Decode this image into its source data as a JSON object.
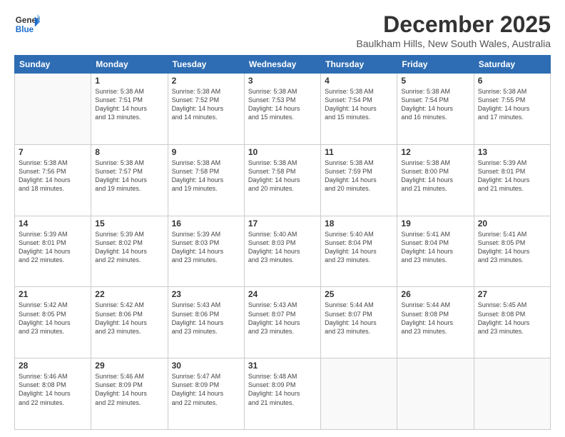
{
  "logo": {
    "line1": "General",
    "line2": "Blue"
  },
  "title": "December 2025",
  "location": "Baulkham Hills, New South Wales, Australia",
  "days_header": [
    "Sunday",
    "Monday",
    "Tuesday",
    "Wednesday",
    "Thursday",
    "Friday",
    "Saturday"
  ],
  "weeks": [
    [
      {
        "day": "",
        "lines": []
      },
      {
        "day": "1",
        "lines": [
          "Sunrise: 5:38 AM",
          "Sunset: 7:51 PM",
          "Daylight: 14 hours",
          "and 13 minutes."
        ]
      },
      {
        "day": "2",
        "lines": [
          "Sunrise: 5:38 AM",
          "Sunset: 7:52 PM",
          "Daylight: 14 hours",
          "and 14 minutes."
        ]
      },
      {
        "day": "3",
        "lines": [
          "Sunrise: 5:38 AM",
          "Sunset: 7:53 PM",
          "Daylight: 14 hours",
          "and 15 minutes."
        ]
      },
      {
        "day": "4",
        "lines": [
          "Sunrise: 5:38 AM",
          "Sunset: 7:54 PM",
          "Daylight: 14 hours",
          "and 15 minutes."
        ]
      },
      {
        "day": "5",
        "lines": [
          "Sunrise: 5:38 AM",
          "Sunset: 7:54 PM",
          "Daylight: 14 hours",
          "and 16 minutes."
        ]
      },
      {
        "day": "6",
        "lines": [
          "Sunrise: 5:38 AM",
          "Sunset: 7:55 PM",
          "Daylight: 14 hours",
          "and 17 minutes."
        ]
      }
    ],
    [
      {
        "day": "7",
        "lines": [
          "Sunrise: 5:38 AM",
          "Sunset: 7:56 PM",
          "Daylight: 14 hours",
          "and 18 minutes."
        ]
      },
      {
        "day": "8",
        "lines": [
          "Sunrise: 5:38 AM",
          "Sunset: 7:57 PM",
          "Daylight: 14 hours",
          "and 19 minutes."
        ]
      },
      {
        "day": "9",
        "lines": [
          "Sunrise: 5:38 AM",
          "Sunset: 7:58 PM",
          "Daylight: 14 hours",
          "and 19 minutes."
        ]
      },
      {
        "day": "10",
        "lines": [
          "Sunrise: 5:38 AM",
          "Sunset: 7:58 PM",
          "Daylight: 14 hours",
          "and 20 minutes."
        ]
      },
      {
        "day": "11",
        "lines": [
          "Sunrise: 5:38 AM",
          "Sunset: 7:59 PM",
          "Daylight: 14 hours",
          "and 20 minutes."
        ]
      },
      {
        "day": "12",
        "lines": [
          "Sunrise: 5:38 AM",
          "Sunset: 8:00 PM",
          "Daylight: 14 hours",
          "and 21 minutes."
        ]
      },
      {
        "day": "13",
        "lines": [
          "Sunrise: 5:39 AM",
          "Sunset: 8:01 PM",
          "Daylight: 14 hours",
          "and 21 minutes."
        ]
      }
    ],
    [
      {
        "day": "14",
        "lines": [
          "Sunrise: 5:39 AM",
          "Sunset: 8:01 PM",
          "Daylight: 14 hours",
          "and 22 minutes."
        ]
      },
      {
        "day": "15",
        "lines": [
          "Sunrise: 5:39 AM",
          "Sunset: 8:02 PM",
          "Daylight: 14 hours",
          "and 22 minutes."
        ]
      },
      {
        "day": "16",
        "lines": [
          "Sunrise: 5:39 AM",
          "Sunset: 8:03 PM",
          "Daylight: 14 hours",
          "and 23 minutes."
        ]
      },
      {
        "day": "17",
        "lines": [
          "Sunrise: 5:40 AM",
          "Sunset: 8:03 PM",
          "Daylight: 14 hours",
          "and 23 minutes."
        ]
      },
      {
        "day": "18",
        "lines": [
          "Sunrise: 5:40 AM",
          "Sunset: 8:04 PM",
          "Daylight: 14 hours",
          "and 23 minutes."
        ]
      },
      {
        "day": "19",
        "lines": [
          "Sunrise: 5:41 AM",
          "Sunset: 8:04 PM",
          "Daylight: 14 hours",
          "and 23 minutes."
        ]
      },
      {
        "day": "20",
        "lines": [
          "Sunrise: 5:41 AM",
          "Sunset: 8:05 PM",
          "Daylight: 14 hours",
          "and 23 minutes."
        ]
      }
    ],
    [
      {
        "day": "21",
        "lines": [
          "Sunrise: 5:42 AM",
          "Sunset: 8:05 PM",
          "Daylight: 14 hours",
          "and 23 minutes."
        ]
      },
      {
        "day": "22",
        "lines": [
          "Sunrise: 5:42 AM",
          "Sunset: 8:06 PM",
          "Daylight: 14 hours",
          "and 23 minutes."
        ]
      },
      {
        "day": "23",
        "lines": [
          "Sunrise: 5:43 AM",
          "Sunset: 8:06 PM",
          "Daylight: 14 hours",
          "and 23 minutes."
        ]
      },
      {
        "day": "24",
        "lines": [
          "Sunrise: 5:43 AM",
          "Sunset: 8:07 PM",
          "Daylight: 14 hours",
          "and 23 minutes."
        ]
      },
      {
        "day": "25",
        "lines": [
          "Sunrise: 5:44 AM",
          "Sunset: 8:07 PM",
          "Daylight: 14 hours",
          "and 23 minutes."
        ]
      },
      {
        "day": "26",
        "lines": [
          "Sunrise: 5:44 AM",
          "Sunset: 8:08 PM",
          "Daylight: 14 hours",
          "and 23 minutes."
        ]
      },
      {
        "day": "27",
        "lines": [
          "Sunrise: 5:45 AM",
          "Sunset: 8:08 PM",
          "Daylight: 14 hours",
          "and 23 minutes."
        ]
      }
    ],
    [
      {
        "day": "28",
        "lines": [
          "Sunrise: 5:46 AM",
          "Sunset: 8:08 PM",
          "Daylight: 14 hours",
          "and 22 minutes."
        ]
      },
      {
        "day": "29",
        "lines": [
          "Sunrise: 5:46 AM",
          "Sunset: 8:09 PM",
          "Daylight: 14 hours",
          "and 22 minutes."
        ]
      },
      {
        "day": "30",
        "lines": [
          "Sunrise: 5:47 AM",
          "Sunset: 8:09 PM",
          "Daylight: 14 hours",
          "and 22 minutes."
        ]
      },
      {
        "day": "31",
        "lines": [
          "Sunrise: 5:48 AM",
          "Sunset: 8:09 PM",
          "Daylight: 14 hours",
          "and 21 minutes."
        ]
      },
      {
        "day": "",
        "lines": []
      },
      {
        "day": "",
        "lines": []
      },
      {
        "day": "",
        "lines": []
      }
    ]
  ]
}
